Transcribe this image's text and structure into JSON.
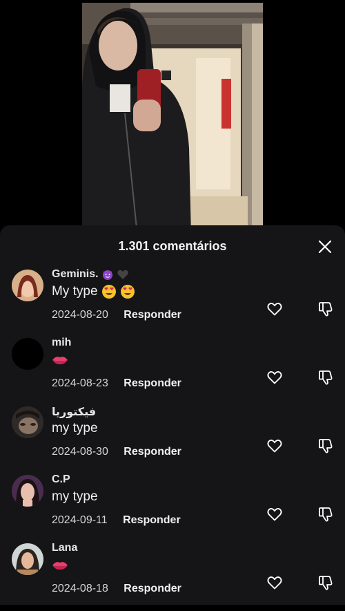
{
  "comments_header": {
    "title": "1.301 comentários"
  },
  "comments": [
    {
      "username": "Geminis.",
      "text": "My type",
      "date": "2024-08-20",
      "reply_label": "Responder",
      "username_emojis": [
        "devil-emoji",
        "black-heart-emoji"
      ],
      "text_emojis": [
        "heart-eyes-emoji",
        "heart-eyes-emoji"
      ]
    },
    {
      "username": "mih",
      "text": "",
      "date": "2024-08-23",
      "reply_label": "Responder",
      "username_emojis": [],
      "text_emojis": [
        "lips-emoji"
      ]
    },
    {
      "username": "فيكتوريا",
      "text": "my type",
      "date": "2024-08-30",
      "reply_label": "Responder",
      "username_emojis": [],
      "text_emojis": []
    },
    {
      "username": "C.P",
      "text": "my type",
      "date": "2024-09-11",
      "reply_label": "Responder",
      "username_emojis": [],
      "text_emojis": []
    },
    {
      "username": "Lana",
      "text": "",
      "date": "2024-08-18",
      "reply_label": "Responder",
      "username_emojis": [],
      "text_emojis": [
        "lips-emoji"
      ]
    }
  ],
  "icons": {
    "close": "close-icon",
    "like": "heart-outline-icon",
    "dislike": "thumbs-down-icon"
  },
  "colors": {
    "sheet_bg": "#151517",
    "text": "#f0f0f0",
    "secondary_text": "#d6d6d6"
  }
}
